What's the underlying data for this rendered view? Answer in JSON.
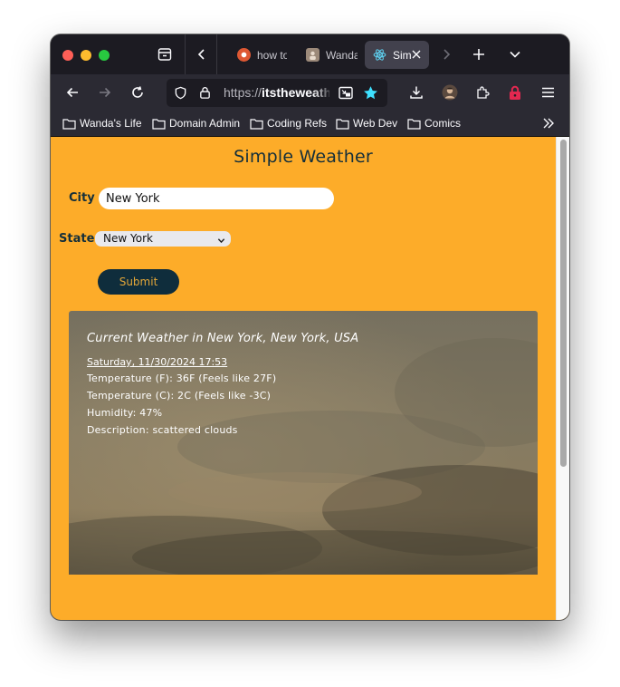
{
  "browser": {
    "tabs": [
      {
        "title": "how to"
      },
      {
        "title": "Wanda"
      },
      {
        "title": "Sim"
      }
    ],
    "url": {
      "scheme": "https://",
      "host": "itstheweath"
    },
    "bookmarks": [
      {
        "label": "Wanda's Life"
      },
      {
        "label": "Domain Admin"
      },
      {
        "label": "Coding Refs"
      },
      {
        "label": "Web Dev"
      },
      {
        "label": "Comics"
      }
    ],
    "colors": {
      "chrome_dark": "#1c1b22",
      "toolbar": "#2b2a33",
      "bookmark_star": "#3fe1ff",
      "lock_red": "#e22850"
    }
  },
  "app": {
    "title": "Simple Weather",
    "form": {
      "city_label": "City",
      "city_value": "New York",
      "state_label": "State",
      "state_selected": "New York",
      "submit_label": "Submit"
    },
    "weather": {
      "heading": "Current Weather in New York, New York, USA",
      "datetime": "Saturday, 11/30/2024 17:53",
      "temp_f": "Temperature (F): 36F (Feels like 27F)",
      "temp_c": "Temperature (C): 2C (Feels like -3C)",
      "humidity": "Humidity: 47%",
      "description": "Description: scattered clouds"
    },
    "colors": {
      "background": "#fdac29",
      "text": "#142f3a",
      "button_bg": "#0f2d3c",
      "button_text": "#e3a638"
    }
  }
}
